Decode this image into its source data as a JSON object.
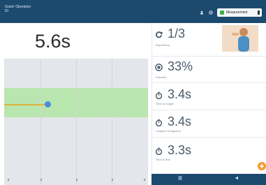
{
  "header": {
    "title": "Grant: Operation\nID",
    "icons": [
      "user-icon",
      "settings-icon"
    ],
    "mode_select": {
      "selected": "Measurement",
      "status_color": "#3cb04a"
    }
  },
  "timer": {
    "elapsed": "5.6s"
  },
  "stats": [
    {
      "icon": "repeat-icon",
      "value": "1/3",
      "label": "Repetitions"
    },
    {
      "icon": "target-icon",
      "value": "33%",
      "label": "Success"
    },
    {
      "icon": "stopwatch-icon",
      "value": "3.4s",
      "label": "Time on target"
    },
    {
      "icon": "stopwatch-icon",
      "value": "3.4s",
      "label": "Longest Contiguous"
    },
    {
      "icon": "stopwatch-icon",
      "value": "3.3s",
      "label": "Time to first"
    }
  ],
  "colors": {
    "primary": "#1c4a6f",
    "band": "#b9e5ae",
    "marker": "#4f8bd8",
    "line": "#e0b23a",
    "accent": "#f39c2e"
  }
}
